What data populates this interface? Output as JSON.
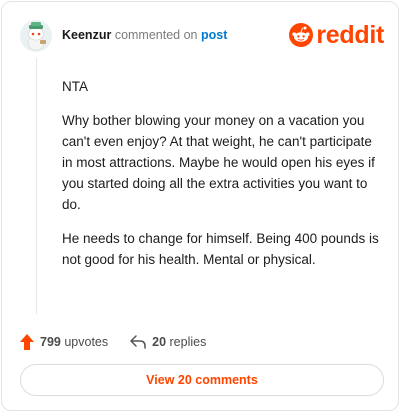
{
  "comment": {
    "author": "Keenzur",
    "verb": "commented on",
    "post_link_label": "post",
    "paragraphs": [
      "NTA",
      "Why bother blowing your money on a vacation you can't even enjoy? At that weight, he can't participate in most attractions. Maybe he would open his eyes if you started doing all the extra activities you want to do.",
      "He needs to change for himself. Being 400 pounds is not good for his health. Mental or physical."
    ]
  },
  "brand": {
    "logo_text": "reddit",
    "accent": "#ff4500"
  },
  "actions": {
    "upvotes_count": "799",
    "upvotes_label": "upvotes",
    "replies_count": "20",
    "replies_label": "replies"
  },
  "view_comments_label": "View 20 comments",
  "icons": [
    "avatar-snoo",
    "reddit-logo-icon",
    "upvote-arrow-icon",
    "reply-arrow-icon"
  ]
}
